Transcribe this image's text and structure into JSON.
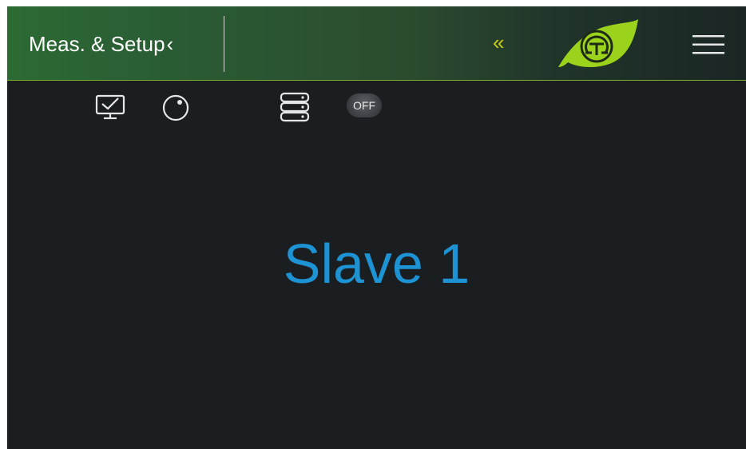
{
  "header": {
    "title": "Meas. & Setup",
    "back_chevron": "‹",
    "collapse_label": "«",
    "logo_icon": "leaf-omega-logo",
    "menu_icon": "hamburger-menu-icon"
  },
  "toolbar": {
    "icons": [
      "monitor-check-icon",
      "dial-icon",
      "server-stack-icon"
    ],
    "toggle_label": "OFF"
  },
  "main": {
    "device_name": "Slave 1"
  },
  "colors": {
    "header_green": "#2c6a33",
    "accent_yellow": "#c9cc1a",
    "logo_green": "#9bd21c",
    "device_blue": "#1e93d3",
    "background": "#1b1e21"
  }
}
